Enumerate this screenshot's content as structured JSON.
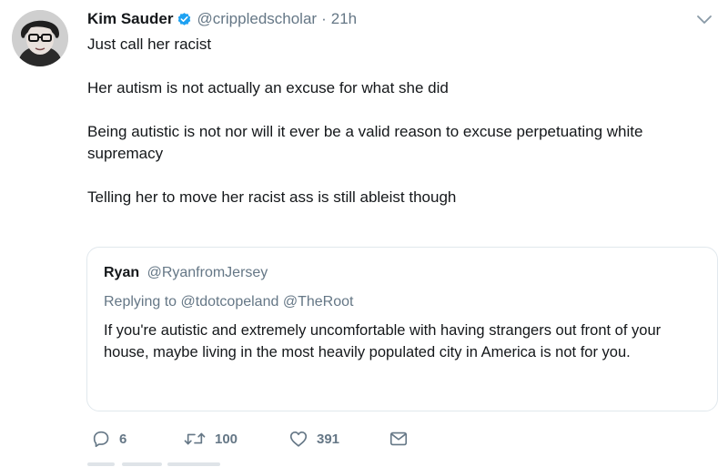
{
  "tweet": {
    "author": {
      "display_name": "Kim Sauder",
      "handle": "@crippledscholar",
      "verified_icon": "verified-badge-icon",
      "avatar": "avatar-photo"
    },
    "separator": "·",
    "time": "21h",
    "menu_icon": "chevron-down-icon",
    "text": {
      "line1": "Just call her racist",
      "para2": "Her autism is not actually an excuse for what she did",
      "para3": "Being autistic is not nor will it ever be a valid reason to excuse perpetuating white supremacy",
      "para4": "Telling her to move her racist ass is still ableist though"
    },
    "quoted_tweet": {
      "display_name": "Ryan",
      "handle": "@RyanfromJersey",
      "replying_prefix": "Replying to",
      "replying_to": [
        "@tdotcopeland",
        "@TheRoot"
      ],
      "text": "If you're autistic and extremely uncomfortable with having strangers out front of your house, maybe living in the most heavily populated city in America is not for you."
    },
    "actions": {
      "reply": {
        "icon": "reply-icon",
        "count": "6"
      },
      "retweet": {
        "icon": "retweet-icon",
        "count": "100"
      },
      "like": {
        "icon": "heart-icon",
        "count": "391"
      },
      "direct_message": {
        "icon": "envelope-icon"
      }
    }
  },
  "colors": {
    "text_primary": "#14171a",
    "text_secondary": "#657786",
    "verified_blue": "#1da1f2",
    "border": "#e1e8ed"
  }
}
